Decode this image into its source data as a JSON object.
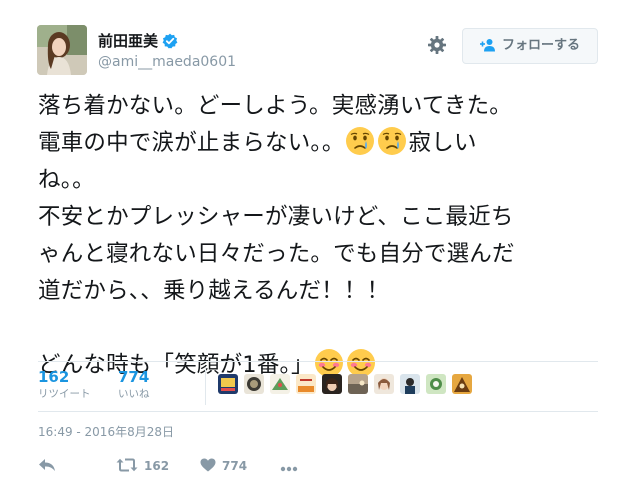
{
  "user": {
    "display_name": "前田亜美",
    "handle": "@ami__maeda0601",
    "verified": true
  },
  "header": {
    "follow_label": "フォローする",
    "follow_icon": "user-plus-icon",
    "settings_icon": "gear-icon"
  },
  "tweet": {
    "lines": [
      "落ち着かない。どーしよう。実感湧いてきた。",
      "電車の中で涙が止まらない。。",
      "寂しい",
      "ね。。",
      "不安とかプレッシャーが凄いけど、ここ最近ち",
      "ゃんと寝れない日々だった。でも自分で選んだ",
      "道だから、、乗り越えるんだ！！！",
      "どんな時も「笑顔が1番。」"
    ],
    "emoji_crying": "crying-face-emoji",
    "emoji_smiling": "smiling-face-blush-emoji"
  },
  "stats": {
    "retweets_count": "162",
    "retweets_label": "リツイート",
    "likes_count": "774",
    "likes_label": "いいね"
  },
  "timestamp": "16:49 - 2016年8月28日",
  "actions": {
    "reply_icon": "reply-icon",
    "retweet_icon": "retweet-icon",
    "retweet_count": "162",
    "like_icon": "heart-icon",
    "like_count": "774",
    "more_icon": "more-dots-icon"
  },
  "colors": {
    "accent": "#1b95e0",
    "verified": "#1da1f2",
    "muted": "#8899a6",
    "text": "#14171a"
  }
}
